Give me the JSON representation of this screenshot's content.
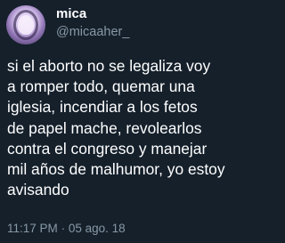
{
  "tweet": {
    "display_name": "mica",
    "handle": "@micaaher_",
    "text": "si el aborto no se legaliza voy\na romper todo, quemar una\niglesia, incendiar a los fetos\nde papel mache, revolearlos\ncontra el congreso y manejar\nmil años de malhumor, yo estoy\navisando",
    "time": "11:17 PM",
    "separator": "·",
    "date": "05 ago. 18"
  },
  "colors": {
    "background": "#15202b",
    "text": "#ffffff",
    "secondary_text": "#8899a6"
  },
  "icons": {
    "avatar": "profile-photo"
  }
}
